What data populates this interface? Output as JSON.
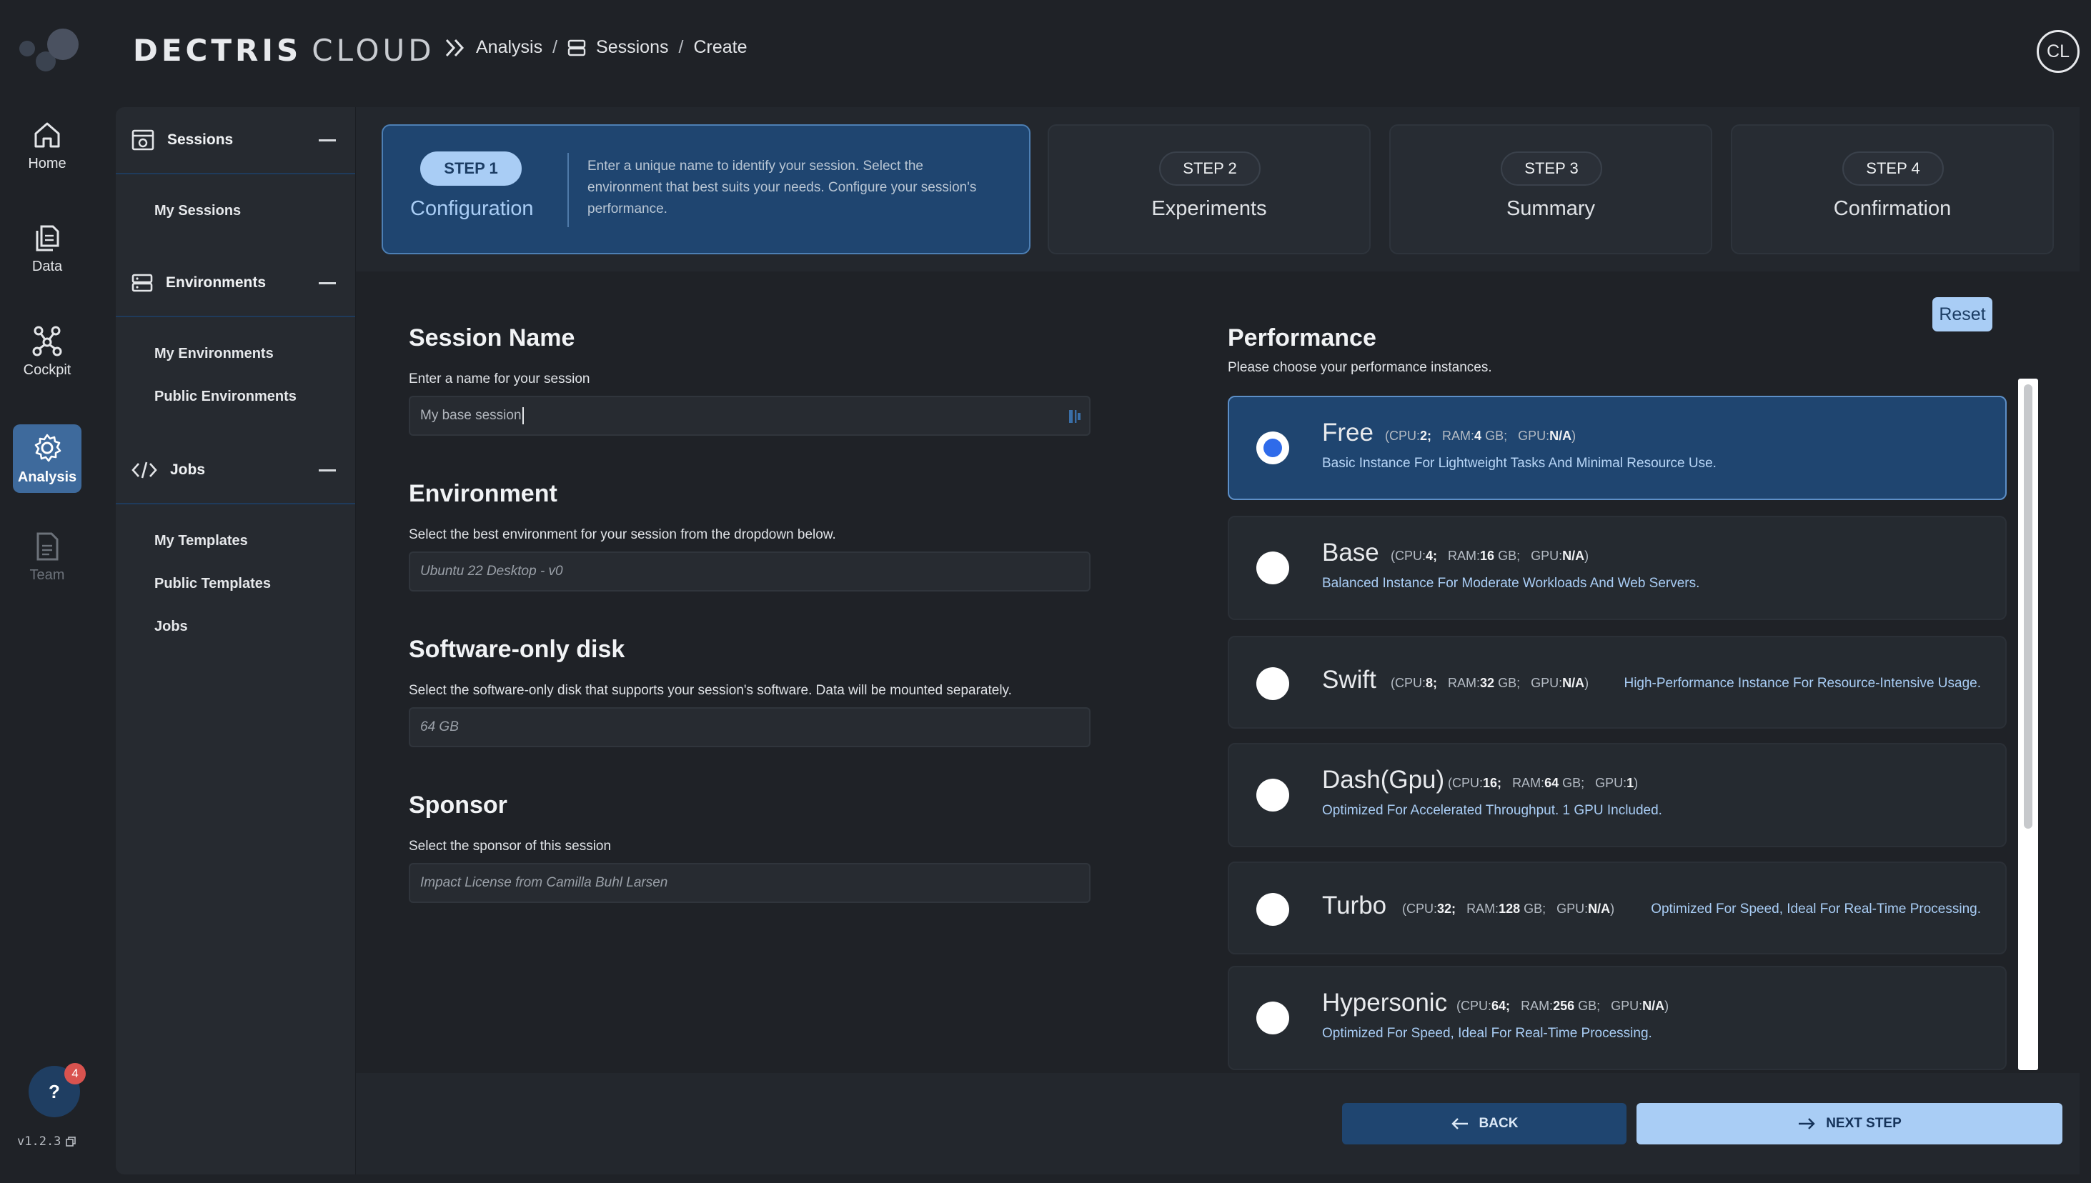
{
  "header": {
    "brand_primary": "DECTRIS",
    "brand_secondary": "CLOUD",
    "breadcrumb": [
      "Analysis",
      "Sessions",
      "Create"
    ],
    "avatar_initials": "CL"
  },
  "rail": {
    "items": [
      {
        "label": "Home",
        "icon": "home-icon"
      },
      {
        "label": "Data",
        "icon": "files-icon"
      },
      {
        "label": "Cockpit",
        "icon": "network-icon"
      },
      {
        "label": "Analysis",
        "icon": "gear-icon",
        "active": true
      },
      {
        "label": "Team",
        "icon": "document-icon",
        "disabled": true
      }
    ],
    "help_label": "?",
    "help_badge": "4",
    "version": "v1.2.3"
  },
  "subnav": {
    "sections": [
      {
        "title": "Sessions",
        "links": [
          "My Sessions"
        ]
      },
      {
        "title": "Environments",
        "links": [
          "My Environments",
          "Public Environments"
        ]
      },
      {
        "title": "Jobs",
        "links": [
          "My Templates",
          "Public Templates",
          "Jobs"
        ]
      }
    ]
  },
  "stepper": {
    "steps": [
      {
        "pill": "STEP 1",
        "title": "Configuration",
        "description": "Enter a unique name to identify your session. Select the environment that best suits your needs. Configure your session's performance.",
        "active": true
      },
      {
        "pill": "STEP 2",
        "title": "Experiments"
      },
      {
        "pill": "STEP 3",
        "title": "Summary"
      },
      {
        "pill": "STEP 4",
        "title": "Confirmation"
      }
    ]
  },
  "form": {
    "session_name": {
      "title": "Session Name",
      "subtitle": "Enter a name for your session",
      "value": "My base session"
    },
    "environment": {
      "title": "Environment",
      "subtitle": "Select the best environment for your session from the dropdown below.",
      "value": "Ubuntu 22 Desktop - v0"
    },
    "disk": {
      "title": "Software-only disk",
      "subtitle": "Select the software-only disk that supports your session's software. Data will be mounted separately.",
      "value": "64 GB"
    },
    "sponsor": {
      "title": "Sponsor",
      "subtitle": "Select the sponsor of this session",
      "value": "Impact License from Camilla Buhl Larsen"
    }
  },
  "performance": {
    "title": "Performance",
    "subtitle": "Please choose your performance instances.",
    "reset_label": "Reset",
    "instances": [
      {
        "name": "Free",
        "cpu": "2",
        "ram": "4",
        "gpu": "N/A",
        "description": "Basic Instance For Lightweight Tasks And Minimal Resource Use.",
        "selected": true
      },
      {
        "name": "Base",
        "cpu": "4",
        "ram": "16",
        "gpu": "N/A",
        "description": "Balanced Instance For Moderate Workloads And Web Servers."
      },
      {
        "name": "Swift",
        "cpu": "8",
        "ram": "32",
        "gpu": "N/A",
        "description": "High-Performance Instance For Resource-Intensive Usage."
      },
      {
        "name": "Dash(Gpu)",
        "cpu": "16",
        "ram": "64",
        "gpu": "1",
        "description": "Optimized For Accelerated Throughput. 1 GPU Included."
      },
      {
        "name": "Turbo",
        "cpu": "32",
        "ram": "128",
        "gpu": "N/A",
        "description": "Optimized For Speed, Ideal For Real-Time Processing."
      },
      {
        "name": "Hypersonic",
        "cpu": "64",
        "ram": "256",
        "gpu": "N/A",
        "description": "Optimized For Speed, Ideal For Real-Time Processing."
      }
    ],
    "spec_labels": {
      "cpu": "CPU:",
      "ram": "RAM:",
      "gpu": "GPU:",
      "gb": "GB"
    }
  },
  "footer": {
    "back_label": "BACK",
    "next_label": "NEXT STEP"
  }
}
